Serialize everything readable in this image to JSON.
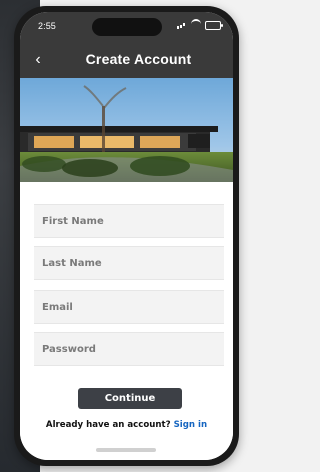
{
  "status": {
    "time": "2:55",
    "icons": [
      "signal-icon",
      "wifi-icon",
      "battery-icon"
    ]
  },
  "nav": {
    "title": "Create Account",
    "back_icon": "chevron-left-icon"
  },
  "hero": {
    "image": "building-photo"
  },
  "form": {
    "first_name_placeholder": "First Name",
    "last_name_placeholder": "Last Name",
    "email_placeholder": "Email",
    "password_placeholder": "Password",
    "continue_label": "Continue",
    "signin_prompt": "Already have an account?",
    "signin_link": "Sign in"
  },
  "colors": {
    "nav_bg": "#3a3a3a",
    "button_bg": "#3d4046",
    "link": "#1565c0"
  }
}
